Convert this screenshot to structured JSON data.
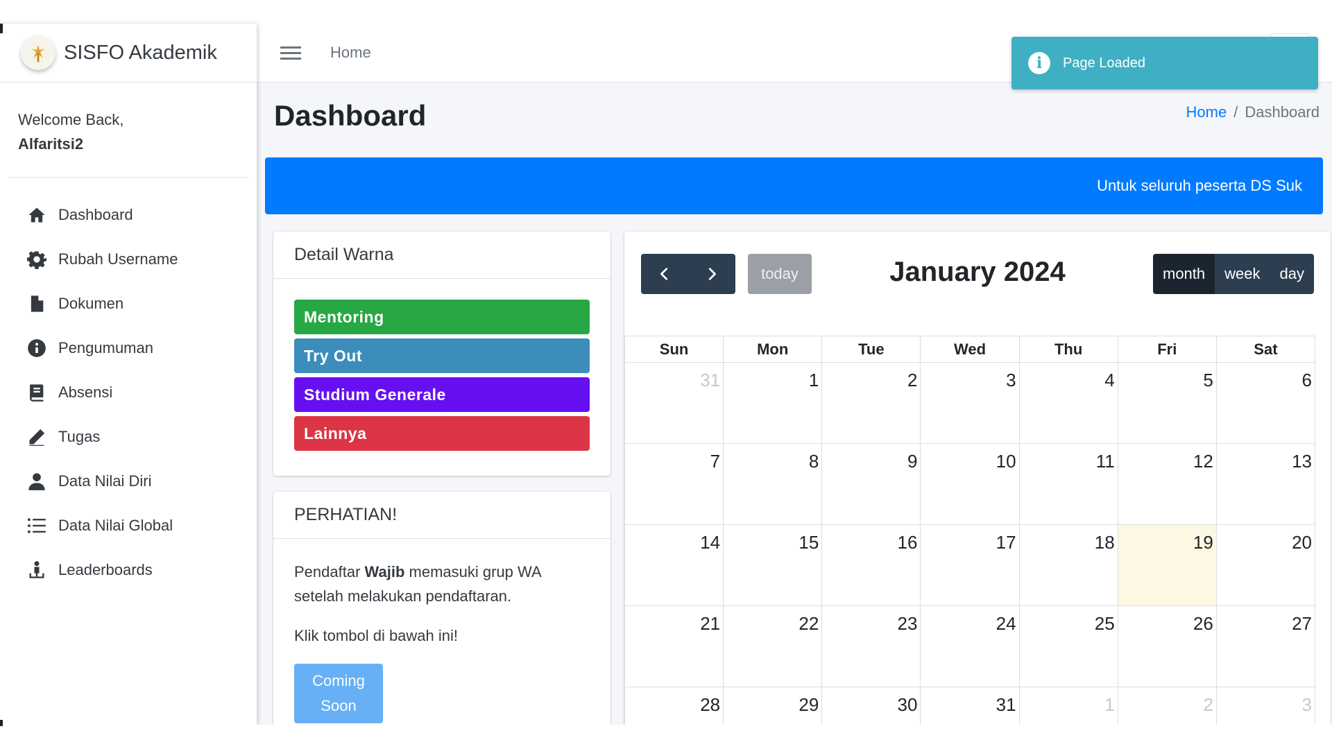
{
  "brand": {
    "name": "SISFO",
    "suffix": "Akademik"
  },
  "user": {
    "greeting": "Welcome Back,",
    "name": "Alfaritsi2"
  },
  "sidebar": {
    "items": [
      {
        "label": "Dashboard",
        "icon": "home-icon"
      },
      {
        "label": "Rubah Username",
        "icon": "gear-icon"
      },
      {
        "label": "Dokumen",
        "icon": "file-icon"
      },
      {
        "label": "Pengumuman",
        "icon": "info-circle-icon"
      },
      {
        "label": "Absensi",
        "icon": "book-icon"
      },
      {
        "label": "Tugas",
        "icon": "pencil-icon"
      },
      {
        "label": "Data Nilai Diri",
        "icon": "user-icon"
      },
      {
        "label": "Data Nilai Global",
        "icon": "list-icon"
      },
      {
        "label": "Leaderboards",
        "icon": "person-medal-icon"
      }
    ]
  },
  "topbar": {
    "home": "Home"
  },
  "page": {
    "title": "Dashboard",
    "breadcrumb": [
      "Home",
      "Dashboard"
    ]
  },
  "marquee": {
    "text": "Untuk seluruh peserta DS Suk"
  },
  "detail_warna": {
    "title": "Detail Warna",
    "items": [
      {
        "label": "Mentoring",
        "color": "#28a745"
      },
      {
        "label": "Try Out",
        "color": "#3c8dbc"
      },
      {
        "label": "Studium Generale",
        "color": "#6610f2"
      },
      {
        "label": "Lainnya",
        "color": "#dc3545"
      }
    ]
  },
  "notice": {
    "title": "PERHATIAN!",
    "line1_pre": "Pendaftar",
    "line1_bold": "Wajib",
    "line1_post": "memasuki grup WA setelah melakukan pendaftaran.",
    "line2": "Klik tombol di bawah ini!",
    "button": "Coming Soon"
  },
  "calendar": {
    "title": "January 2024",
    "today_label": "today",
    "views": [
      "month",
      "week",
      "day"
    ],
    "active_view": "month",
    "weekdays": [
      "Sun",
      "Mon",
      "Tue",
      "Wed",
      "Thu",
      "Fri",
      "Sat"
    ],
    "weeks": [
      [
        "31",
        "1",
        "2",
        "3",
        "4",
        "5",
        "6"
      ],
      [
        "7",
        "8",
        "9",
        "10",
        "11",
        "12",
        "13"
      ],
      [
        "14",
        "15",
        "16",
        "17",
        "18",
        "19",
        "20"
      ],
      [
        "21",
        "22",
        "23",
        "24",
        "25",
        "26",
        "27"
      ],
      [
        "28",
        "29",
        "30",
        "31",
        "1",
        "2",
        "3"
      ]
    ],
    "today": "19"
  },
  "toast": {
    "message": "Page Loaded",
    "icon": "info-icon"
  }
}
